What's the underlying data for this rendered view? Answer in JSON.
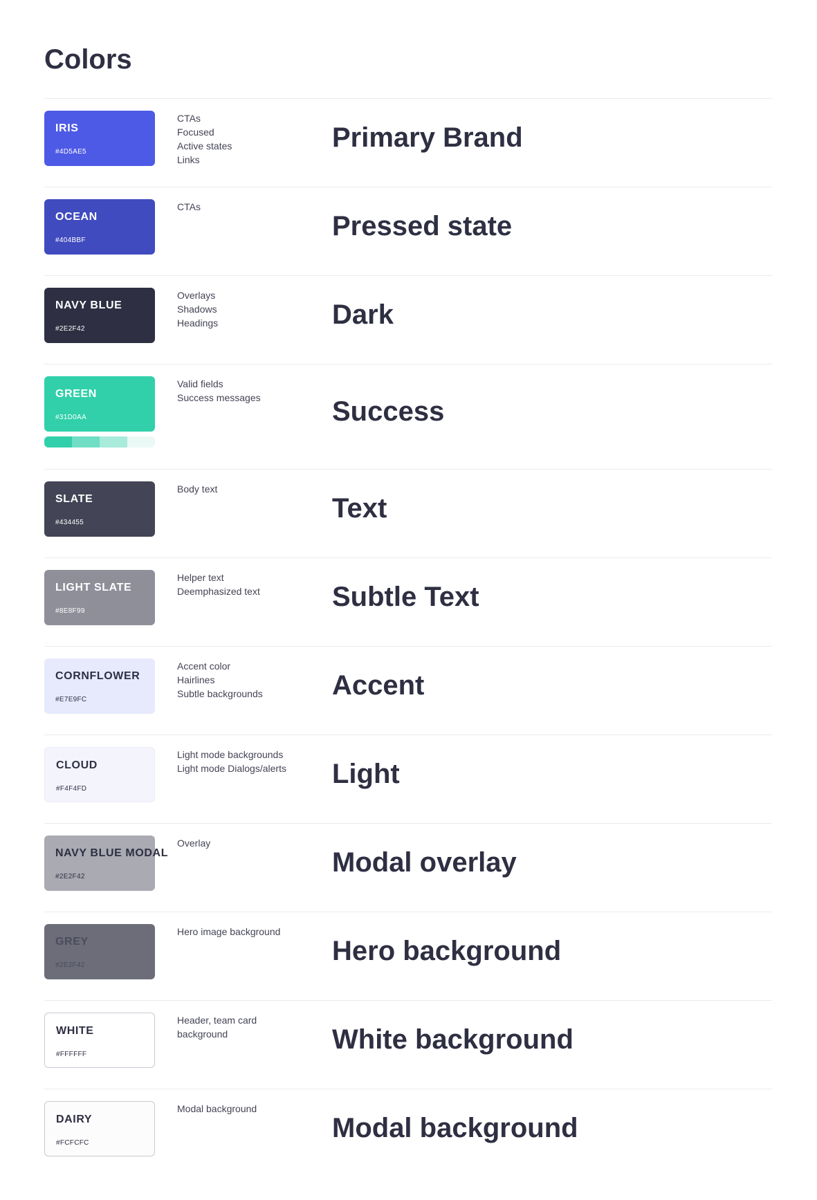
{
  "page": {
    "title": "Colors"
  },
  "colors": [
    {
      "name": "IRIS",
      "hex": "#4D5AE5",
      "swatch_color": "#4D5AE5",
      "text_color": "#FFFFFF",
      "usage": [
        "CTAs",
        "Focused",
        "Active states",
        "Links"
      ],
      "role": "Primary Brand"
    },
    {
      "name": "OCEAN",
      "hex": "#404BBF",
      "swatch_color": "#404BBF",
      "text_color": "#FFFFFF",
      "usage": [
        "CTAs"
      ],
      "role": "Pressed state"
    },
    {
      "name": "NAVY BLUE",
      "hex": "#2E2F42",
      "swatch_color": "#2E2F42",
      "text_color": "#FFFFFF",
      "usage": [
        "Overlays",
        "Shadows",
        "Headings"
      ],
      "role": "Dark"
    },
    {
      "name": "GREEN",
      "hex": "#31D0AA",
      "swatch_color": "#31D0AA",
      "text_color": "#FFFFFF",
      "usage": [
        "Valid fields",
        "Success messages"
      ],
      "role": "Success",
      "tints": [
        "#31D0AA",
        "#6FDEC4",
        "#A8EBDB",
        "#EAF9F5"
      ]
    },
    {
      "name": "SLATE",
      "hex": "#434455",
      "swatch_color": "#434455",
      "text_color": "#FFFFFF",
      "usage": [
        "Body text"
      ],
      "role": "Text"
    },
    {
      "name": "LIGHT SLATE",
      "hex": "#8E8F99",
      "swatch_color": "#8E8F99",
      "text_color": "#FFFFFF",
      "usage": [
        "Helper text",
        "Deemphasized text"
      ],
      "role": "Subtle Text"
    },
    {
      "name": "CORNFLOWER",
      "hex": "#E7E9FC",
      "swatch_color": "#E7E9FC",
      "text_color": "#2E2F42",
      "usage": [
        "Accent color",
        "Hairlines",
        "Subtle backgrounds"
      ],
      "role": "Accent"
    },
    {
      "name": "CLOUD",
      "hex": "#F4F4FD",
      "swatch_color": "#F4F4FD",
      "text_color": "#2E2F42",
      "usage": [
        "Light mode backgrounds",
        "Light mode Dialogs/alerts"
      ],
      "role": "Light",
      "faint_border": true
    },
    {
      "name": "NAVY BLUE MODAL",
      "hex": "#2E2F42",
      "swatch_color": "#A9AAB2",
      "text_color": "#2E2F42",
      "usage": [
        "Overlay"
      ],
      "role": "Modal overlay"
    },
    {
      "name": "GREY",
      "hex": "#2E2F42",
      "swatch_color": "#6C6D79",
      "text_color": "#4A4B5C",
      "usage": [
        "Hero image background"
      ],
      "role": "Hero background"
    },
    {
      "name": "WHITE",
      "hex": "#FFFFFF",
      "swatch_color": "#FFFFFF",
      "text_color": "#2E2F42",
      "usage": [
        "Header,  team card",
        "background"
      ],
      "role": "White background",
      "outlined": true
    },
    {
      "name": "DAIRY",
      "hex": "#FCFCFC",
      "swatch_color": "#FCFCFC",
      "text_color": "#2E2F42",
      "usage": [
        "Modal background"
      ],
      "role": "Modal background",
      "outlined": true
    }
  ]
}
